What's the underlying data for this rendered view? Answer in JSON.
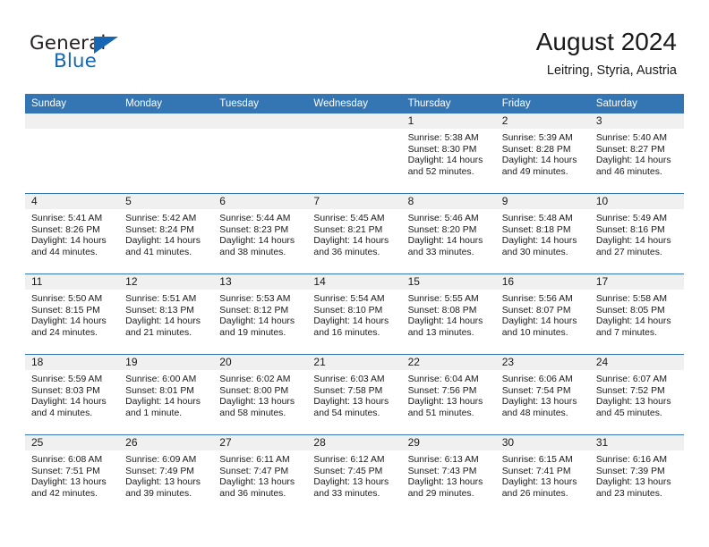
{
  "brand": {
    "name_part1": "General",
    "name_part2": "Blue",
    "dark_color": "#231f20",
    "accent_color": "#1567b3"
  },
  "header": {
    "title": "August 2024",
    "subtitle": "Leitring, Styria, Austria"
  },
  "theme": {
    "header_row_bg": "#3475b4",
    "daynum_band_bg": "#f0f0f0",
    "grid_line": "#3475b4",
    "text": "#1a1a1a"
  },
  "weekdays": [
    "Sunday",
    "Monday",
    "Tuesday",
    "Wednesday",
    "Thursday",
    "Friday",
    "Saturday"
  ],
  "labels": {
    "sunrise_prefix": "Sunrise:",
    "sunset_prefix": "Sunset:",
    "daylight_prefix": "Daylight:"
  },
  "weeks": [
    [
      {
        "day": "",
        "empty": true
      },
      {
        "day": "",
        "empty": true
      },
      {
        "day": "",
        "empty": true
      },
      {
        "day": "",
        "empty": true
      },
      {
        "day": "1",
        "sunrise": "Sunrise: 5:38 AM",
        "sunset": "Sunset: 8:30 PM",
        "daylight_line1": "Daylight: 14 hours",
        "daylight_line2": "and 52 minutes."
      },
      {
        "day": "2",
        "sunrise": "Sunrise: 5:39 AM",
        "sunset": "Sunset: 8:28 PM",
        "daylight_line1": "Daylight: 14 hours",
        "daylight_line2": "and 49 minutes."
      },
      {
        "day": "3",
        "sunrise": "Sunrise: 5:40 AM",
        "sunset": "Sunset: 8:27 PM",
        "daylight_line1": "Daylight: 14 hours",
        "daylight_line2": "and 46 minutes."
      }
    ],
    [
      {
        "day": "4",
        "sunrise": "Sunrise: 5:41 AM",
        "sunset": "Sunset: 8:26 PM",
        "daylight_line1": "Daylight: 14 hours",
        "daylight_line2": "and 44 minutes."
      },
      {
        "day": "5",
        "sunrise": "Sunrise: 5:42 AM",
        "sunset": "Sunset: 8:24 PM",
        "daylight_line1": "Daylight: 14 hours",
        "daylight_line2": "and 41 minutes."
      },
      {
        "day": "6",
        "sunrise": "Sunrise: 5:44 AM",
        "sunset": "Sunset: 8:23 PM",
        "daylight_line1": "Daylight: 14 hours",
        "daylight_line2": "and 38 minutes."
      },
      {
        "day": "7",
        "sunrise": "Sunrise: 5:45 AM",
        "sunset": "Sunset: 8:21 PM",
        "daylight_line1": "Daylight: 14 hours",
        "daylight_line2": "and 36 minutes."
      },
      {
        "day": "8",
        "sunrise": "Sunrise: 5:46 AM",
        "sunset": "Sunset: 8:20 PM",
        "daylight_line1": "Daylight: 14 hours",
        "daylight_line2": "and 33 minutes."
      },
      {
        "day": "9",
        "sunrise": "Sunrise: 5:48 AM",
        "sunset": "Sunset: 8:18 PM",
        "daylight_line1": "Daylight: 14 hours",
        "daylight_line2": "and 30 minutes."
      },
      {
        "day": "10",
        "sunrise": "Sunrise: 5:49 AM",
        "sunset": "Sunset: 8:16 PM",
        "daylight_line1": "Daylight: 14 hours",
        "daylight_line2": "and 27 minutes."
      }
    ],
    [
      {
        "day": "11",
        "sunrise": "Sunrise: 5:50 AM",
        "sunset": "Sunset: 8:15 PM",
        "daylight_line1": "Daylight: 14 hours",
        "daylight_line2": "and 24 minutes."
      },
      {
        "day": "12",
        "sunrise": "Sunrise: 5:51 AM",
        "sunset": "Sunset: 8:13 PM",
        "daylight_line1": "Daylight: 14 hours",
        "daylight_line2": "and 21 minutes."
      },
      {
        "day": "13",
        "sunrise": "Sunrise: 5:53 AM",
        "sunset": "Sunset: 8:12 PM",
        "daylight_line1": "Daylight: 14 hours",
        "daylight_line2": "and 19 minutes."
      },
      {
        "day": "14",
        "sunrise": "Sunrise: 5:54 AM",
        "sunset": "Sunset: 8:10 PM",
        "daylight_line1": "Daylight: 14 hours",
        "daylight_line2": "and 16 minutes."
      },
      {
        "day": "15",
        "sunrise": "Sunrise: 5:55 AM",
        "sunset": "Sunset: 8:08 PM",
        "daylight_line1": "Daylight: 14 hours",
        "daylight_line2": "and 13 minutes."
      },
      {
        "day": "16",
        "sunrise": "Sunrise: 5:56 AM",
        "sunset": "Sunset: 8:07 PM",
        "daylight_line1": "Daylight: 14 hours",
        "daylight_line2": "and 10 minutes."
      },
      {
        "day": "17",
        "sunrise": "Sunrise: 5:58 AM",
        "sunset": "Sunset: 8:05 PM",
        "daylight_line1": "Daylight: 14 hours",
        "daylight_line2": "and 7 minutes."
      }
    ],
    [
      {
        "day": "18",
        "sunrise": "Sunrise: 5:59 AM",
        "sunset": "Sunset: 8:03 PM",
        "daylight_line1": "Daylight: 14 hours",
        "daylight_line2": "and 4 minutes."
      },
      {
        "day": "19",
        "sunrise": "Sunrise: 6:00 AM",
        "sunset": "Sunset: 8:01 PM",
        "daylight_line1": "Daylight: 14 hours",
        "daylight_line2": "and 1 minute."
      },
      {
        "day": "20",
        "sunrise": "Sunrise: 6:02 AM",
        "sunset": "Sunset: 8:00 PM",
        "daylight_line1": "Daylight: 13 hours",
        "daylight_line2": "and 58 minutes."
      },
      {
        "day": "21",
        "sunrise": "Sunrise: 6:03 AM",
        "sunset": "Sunset: 7:58 PM",
        "daylight_line1": "Daylight: 13 hours",
        "daylight_line2": "and 54 minutes."
      },
      {
        "day": "22",
        "sunrise": "Sunrise: 6:04 AM",
        "sunset": "Sunset: 7:56 PM",
        "daylight_line1": "Daylight: 13 hours",
        "daylight_line2": "and 51 minutes."
      },
      {
        "day": "23",
        "sunrise": "Sunrise: 6:06 AM",
        "sunset": "Sunset: 7:54 PM",
        "daylight_line1": "Daylight: 13 hours",
        "daylight_line2": "and 48 minutes."
      },
      {
        "day": "24",
        "sunrise": "Sunrise: 6:07 AM",
        "sunset": "Sunset: 7:52 PM",
        "daylight_line1": "Daylight: 13 hours",
        "daylight_line2": "and 45 minutes."
      }
    ],
    [
      {
        "day": "25",
        "sunrise": "Sunrise: 6:08 AM",
        "sunset": "Sunset: 7:51 PM",
        "daylight_line1": "Daylight: 13 hours",
        "daylight_line2": "and 42 minutes."
      },
      {
        "day": "26",
        "sunrise": "Sunrise: 6:09 AM",
        "sunset": "Sunset: 7:49 PM",
        "daylight_line1": "Daylight: 13 hours",
        "daylight_line2": "and 39 minutes."
      },
      {
        "day": "27",
        "sunrise": "Sunrise: 6:11 AM",
        "sunset": "Sunset: 7:47 PM",
        "daylight_line1": "Daylight: 13 hours",
        "daylight_line2": "and 36 minutes."
      },
      {
        "day": "28",
        "sunrise": "Sunrise: 6:12 AM",
        "sunset": "Sunset: 7:45 PM",
        "daylight_line1": "Daylight: 13 hours",
        "daylight_line2": "and 33 minutes."
      },
      {
        "day": "29",
        "sunrise": "Sunrise: 6:13 AM",
        "sunset": "Sunset: 7:43 PM",
        "daylight_line1": "Daylight: 13 hours",
        "daylight_line2": "and 29 minutes."
      },
      {
        "day": "30",
        "sunrise": "Sunrise: 6:15 AM",
        "sunset": "Sunset: 7:41 PM",
        "daylight_line1": "Daylight: 13 hours",
        "daylight_line2": "and 26 minutes."
      },
      {
        "day": "31",
        "sunrise": "Sunrise: 6:16 AM",
        "sunset": "Sunset: 7:39 PM",
        "daylight_line1": "Daylight: 13 hours",
        "daylight_line2": "and 23 minutes."
      }
    ]
  ]
}
